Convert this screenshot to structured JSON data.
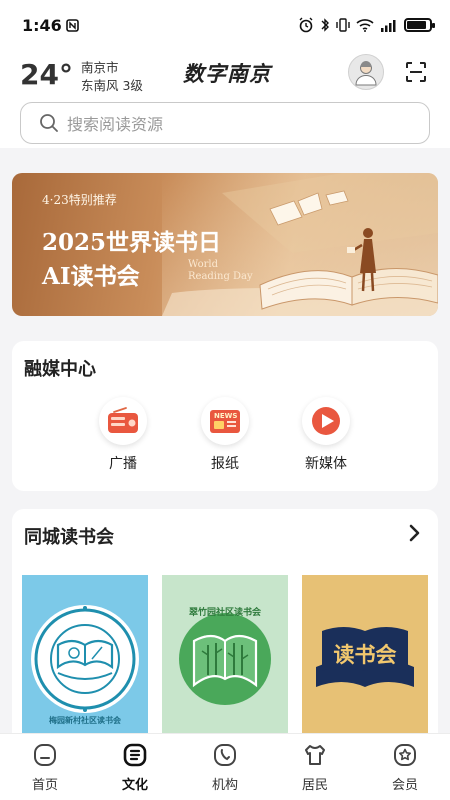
{
  "status": {
    "time": "1:46"
  },
  "header": {
    "temperature": "24°",
    "city": "南京市",
    "wind": "东南风 3级",
    "app_title": "数字南京"
  },
  "search": {
    "placeholder": "搜索阅读资源"
  },
  "banner": {
    "tag": "4·23特别推荐",
    "title_line1": "2025世界读书日",
    "title_line2": "AI读书会",
    "subtitle_en_line1": "World",
    "subtitle_en_line2": "Reading Day"
  },
  "media_center": {
    "title": "融媒中心",
    "items": [
      {
        "label": "广播",
        "icon": "radio-icon"
      },
      {
        "label": "报纸",
        "icon": "newspaper-icon"
      },
      {
        "label": "新媒体",
        "icon": "play-icon"
      }
    ]
  },
  "book_club": {
    "title": "同城读书会",
    "clubs": [
      {
        "name": "梅园新村社区读书会",
        "badge_text": "梅园新村社区读书会",
        "bg": "#7cc9e8"
      },
      {
        "name": "翠竹园社区读书会",
        "badge_text": "翠竹园社区读书会",
        "bg": "#bfe2c4"
      },
      {
        "name": "读书会",
        "badge_text": "读书会",
        "bg": "#e7c175"
      }
    ]
  },
  "tabs": [
    {
      "label": "首页",
      "icon": "home-icon",
      "active": false
    },
    {
      "label": "文化",
      "icon": "culture-icon",
      "active": true
    },
    {
      "label": "机构",
      "icon": "phone-icon",
      "active": false
    },
    {
      "label": "居民",
      "icon": "resident-icon",
      "active": false
    },
    {
      "label": "会员",
      "icon": "member-star-icon",
      "active": false
    }
  ],
  "colors": {
    "accent_red": "#e94b3c",
    "banner_brown": "#b8784a"
  }
}
